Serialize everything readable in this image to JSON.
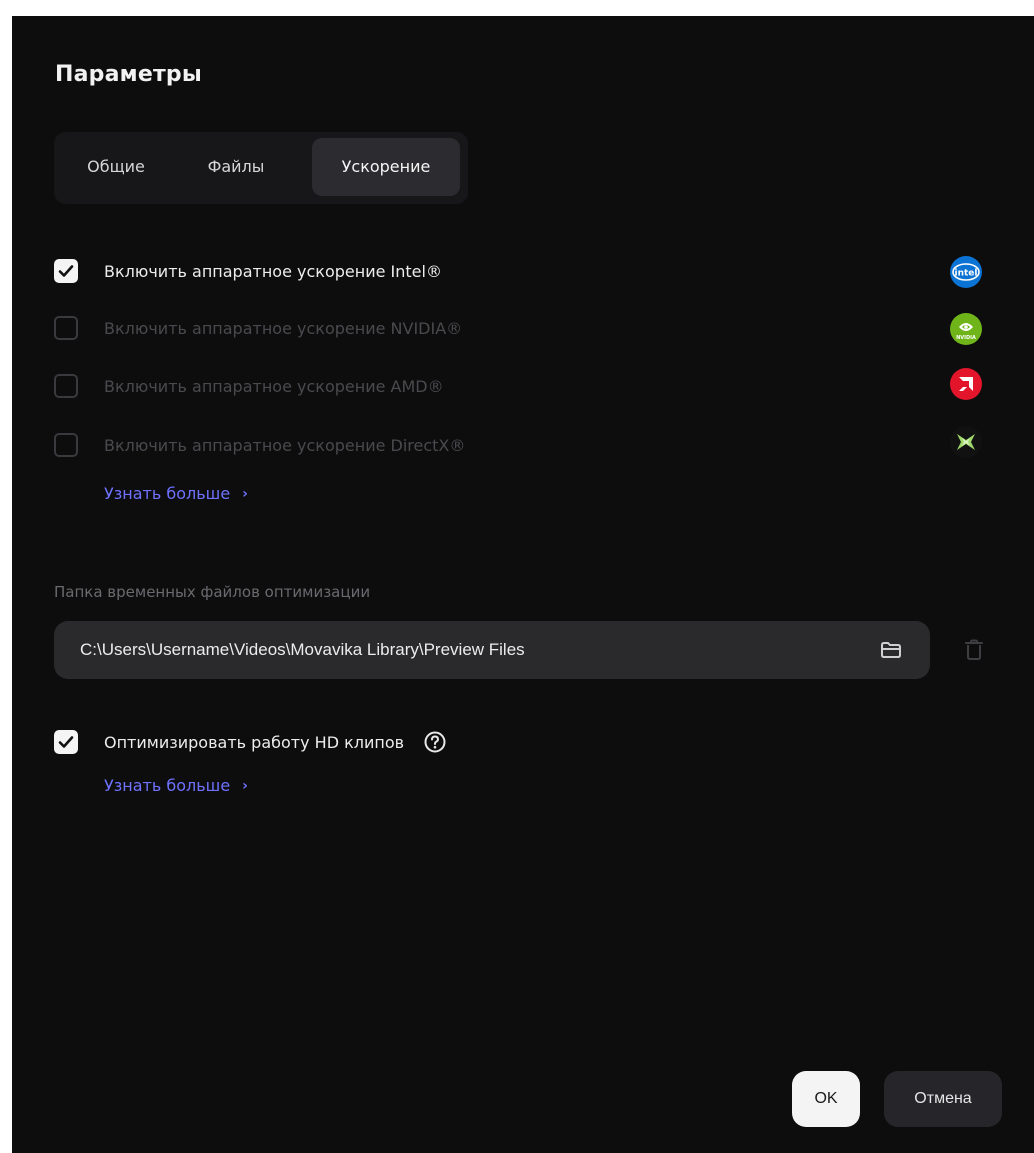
{
  "dialog": {
    "title": "Параметры"
  },
  "tabs": [
    {
      "label": "Общие",
      "active": false
    },
    {
      "label": "Файлы",
      "active": false
    },
    {
      "label": "Ускорение",
      "active": true
    }
  ],
  "acceleration": {
    "options": [
      {
        "label": "Включить аппаратное ускорение Intel®",
        "checked": true,
        "enabled": true,
        "vendor_icon": "intel-logo-icon"
      },
      {
        "label": "Включить аппаратное ускорение NVIDIA®",
        "checked": false,
        "enabled": false,
        "vendor_icon": "nvidia-logo-icon"
      },
      {
        "label": "Включить аппаратное ускорение AMD®",
        "checked": false,
        "enabled": false,
        "vendor_icon": "amd-logo-icon"
      },
      {
        "label": "Включить аппаратное ускорение DirectX®",
        "checked": false,
        "enabled": false,
        "vendor_icon": "directx-logo-icon"
      }
    ],
    "learn_more": "Узнать больше",
    "vendor_logo_text": {
      "intel": "intel",
      "nvidia": "NVIDIA"
    }
  },
  "temp_folder": {
    "label": "Папка временных файлов оптимизации",
    "path": "C:\\Users\\Username\\Videos\\Movavika Library\\Preview Files"
  },
  "hd_optimization": {
    "label": "Оптимизировать работу HD клипов",
    "checked": true,
    "learn_more": "Узнать больше"
  },
  "buttons": {
    "ok": "OK",
    "cancel": "Отмена"
  },
  "colors": {
    "background": "#0d0d0e",
    "link": "#6f72ff",
    "active_tab": "#2c2c30",
    "intel": "#0b73d3",
    "nvidia": "#6fb51a",
    "amd": "#e2152b"
  }
}
